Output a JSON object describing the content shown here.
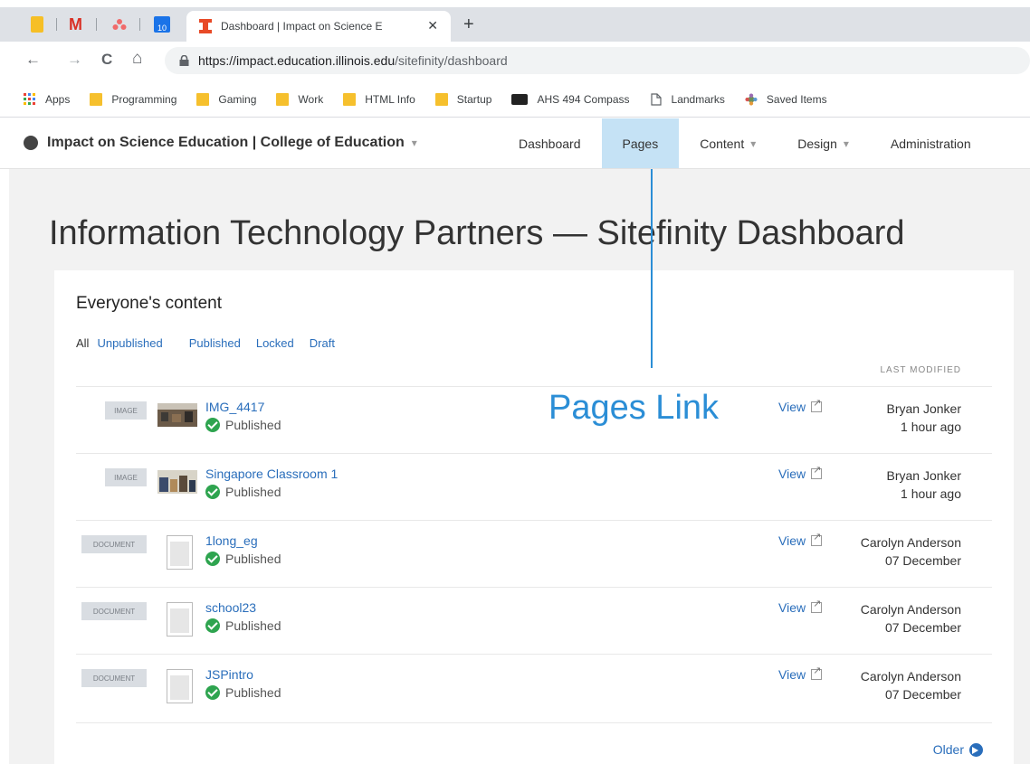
{
  "browser": {
    "tab_title": "Dashboard | Impact on Science E",
    "tab_close": "✕",
    "new_tab": "+",
    "pinned_tabs": [
      {
        "icon": "keep-icon",
        "color": "#f6bf26"
      },
      {
        "icon": "gmail-icon",
        "color": "#d93025"
      },
      {
        "icon": "asana-icon",
        "color": "#f06a6a"
      },
      {
        "icon": "calendar-icon",
        "color": "#1a73e8",
        "text": "10"
      }
    ],
    "url_host": "https://impact.education.illinois.edu",
    "url_path": "/sitefinity/dashboard",
    "nav": {
      "back": "←",
      "forward": "→",
      "reload": "C",
      "home": "⌂"
    }
  },
  "bookmarks": [
    {
      "label": "Apps",
      "icon": "apps-grid-icon"
    },
    {
      "label": "Programming",
      "icon": "folder-icon"
    },
    {
      "label": "Gaming",
      "icon": "folder-icon"
    },
    {
      "label": "Work",
      "icon": "folder-icon"
    },
    {
      "label": "HTML Info",
      "icon": "folder-icon"
    },
    {
      "label": "Startup",
      "icon": "folder-icon"
    },
    {
      "label": "AHS 494 Compass",
      "icon": "compass-bb-icon"
    },
    {
      "label": "Landmarks",
      "icon": "page-icon"
    },
    {
      "label": "Saved Items",
      "icon": "saved-items-icon"
    }
  ],
  "header": {
    "site_name": "Impact on Science Education | College of Education",
    "caret": "▾",
    "nav": [
      {
        "label": "Dashboard",
        "active": false,
        "dropdown": false
      },
      {
        "label": "Pages",
        "active": true,
        "dropdown": false
      },
      {
        "label": "Content",
        "active": false,
        "dropdown": true
      },
      {
        "label": "Design",
        "active": false,
        "dropdown": true
      },
      {
        "label": "Administration",
        "active": false,
        "dropdown": false
      }
    ]
  },
  "main": {
    "page_title": "Information Technology Partners — Sitefinity Dashboard",
    "panel_title": "Everyone's content",
    "filters": [
      "All",
      "Unpublished",
      "Published",
      "Locked",
      "Draft"
    ],
    "last_modified_header": "LAST MODIFIED",
    "view_label": "View",
    "status_label": "Published",
    "older_label": "Older",
    "items": [
      {
        "type": "IMAGE",
        "title": "IMG_4417",
        "author": "Bryan Jonker",
        "time": "1 hour ago"
      },
      {
        "type": "IMAGE",
        "title": "Singapore Classroom 1",
        "author": "Bryan Jonker",
        "time": "1 hour ago"
      },
      {
        "type": "DOCUMENT",
        "title": "1long_eg",
        "author": "Carolyn Anderson",
        "time": "07 December"
      },
      {
        "type": "DOCUMENT",
        "title": "school23",
        "author": "Carolyn Anderson",
        "time": "07 December"
      },
      {
        "type": "DOCUMENT",
        "title": "JSPintro",
        "author": "Carolyn Anderson",
        "time": "07 December"
      }
    ]
  },
  "annotation": {
    "label": "Pages Link",
    "color": "#2b8ed6"
  }
}
